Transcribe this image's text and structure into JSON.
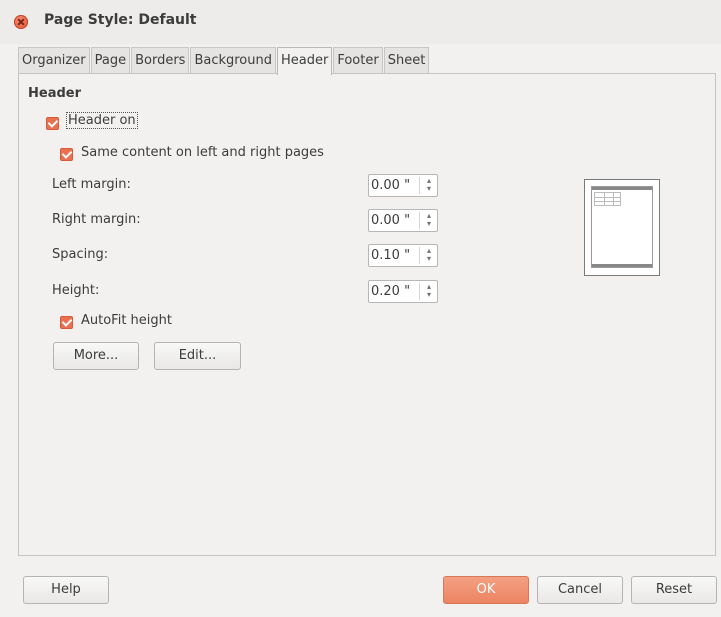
{
  "window": {
    "title": "Page Style: Default"
  },
  "tabs": [
    {
      "label": "Organizer",
      "active": false
    },
    {
      "label": "Page",
      "active": false
    },
    {
      "label": "Borders",
      "active": false
    },
    {
      "label": "Background",
      "active": false
    },
    {
      "label": "Header",
      "active": true
    },
    {
      "label": "Footer",
      "active": false
    },
    {
      "label": "Sheet",
      "active": false
    }
  ],
  "header_section": {
    "title": "Header",
    "header_on": {
      "label": "Header on",
      "checked": true
    },
    "same_content": {
      "label": "Same content on left and right pages",
      "checked": true
    },
    "fields": {
      "left_margin": {
        "label": "Left margin:",
        "value": "0.00 \""
      },
      "right_margin": {
        "label": "Right margin:",
        "value": "0.00 \""
      },
      "spacing": {
        "label": "Spacing:",
        "value": "0.10 \""
      },
      "height": {
        "label": "Height:",
        "value": "0.20 \""
      }
    },
    "autofit": {
      "label": "AutoFit height",
      "checked": true
    },
    "more_button": "More...",
    "edit_button": "Edit..."
  },
  "footer_buttons": {
    "help": "Help",
    "ok": "OK",
    "cancel": "Cancel",
    "reset": "Reset"
  },
  "colors": {
    "accent": "#e9714f",
    "background": "#f2f1f0"
  }
}
